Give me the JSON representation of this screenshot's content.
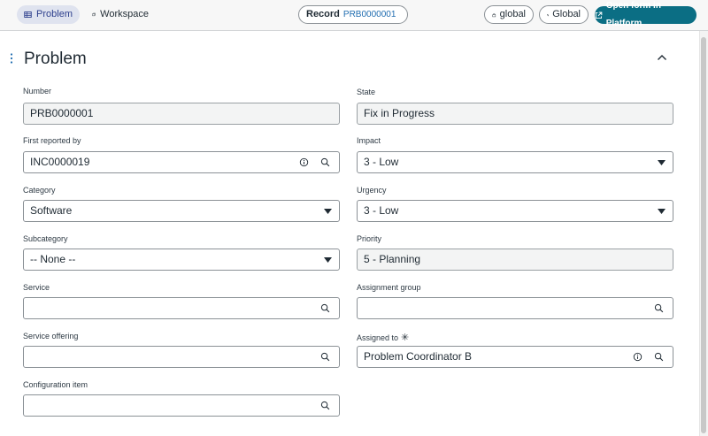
{
  "tabs": {
    "problem_label": "Problem",
    "workspace_label": "Workspace"
  },
  "record": {
    "label": "Record",
    "number": "PRB0000001"
  },
  "scope": {
    "label": "global"
  },
  "application": {
    "label": "Global"
  },
  "open_platform": {
    "label": "Open form in Platform"
  },
  "form": {
    "title": "Problem",
    "fields": {
      "number": {
        "label": "Number",
        "value": "PRB0000001"
      },
      "state": {
        "label": "State",
        "value": "Fix in Progress"
      },
      "first_reported_by": {
        "label": "First reported by",
        "value": "INC0000019"
      },
      "impact": {
        "label": "Impact",
        "value": "3 - Low"
      },
      "category": {
        "label": "Category",
        "value": "Software"
      },
      "urgency": {
        "label": "Urgency",
        "value": "3 - Low"
      },
      "subcategory": {
        "label": "Subcategory",
        "value": "-- None --"
      },
      "priority": {
        "label": "Priority",
        "value": "5 - Planning"
      },
      "service": {
        "label": "Service",
        "value": ""
      },
      "assignment_group": {
        "label": "Assignment group",
        "value": ""
      },
      "service_offering": {
        "label": "Service offering",
        "value": ""
      },
      "assigned_to": {
        "label": "Assigned to",
        "value": "Problem Coordinator B",
        "required_mark": "✳"
      },
      "configuration_item": {
        "label": "Configuration item",
        "value": ""
      }
    }
  },
  "colors": {
    "accent": "#0b6e84",
    "tab_active_bg": "#dfe3ef",
    "record_link": "#1f6cb0"
  }
}
